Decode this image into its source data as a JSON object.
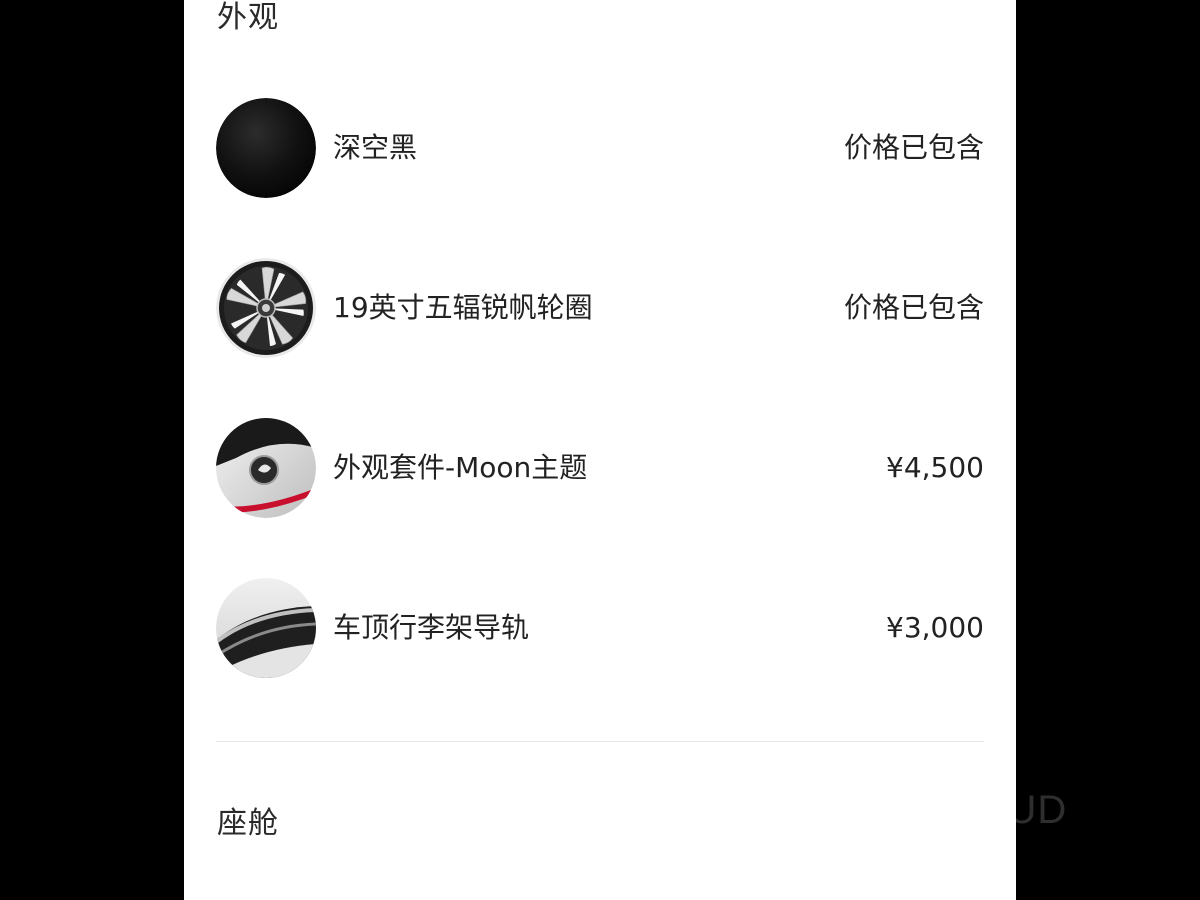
{
  "sections": {
    "exterior_title": "外观",
    "cabin_title": "座舱"
  },
  "options": [
    {
      "label": "深空黑",
      "price": "价格已包含",
      "icon": "black-paint-swatch-icon"
    },
    {
      "label": "19英寸五辐锐帆轮圈",
      "price": "价格已包含",
      "icon": "wheel-rim-icon"
    },
    {
      "label": "外观套件-Moon主题",
      "price": "¥4,500",
      "icon": "moon-theme-badge-icon"
    },
    {
      "label": "车顶行李架导轨",
      "price": "¥3,000",
      "icon": "roof-rail-icon"
    }
  ],
  "watermark": "WEB-STUD",
  "colors": {
    "background": "#000000",
    "panel": "#ffffff",
    "text": "#222222",
    "divider": "#e6e6e6",
    "accent_red": "#c8102e"
  }
}
